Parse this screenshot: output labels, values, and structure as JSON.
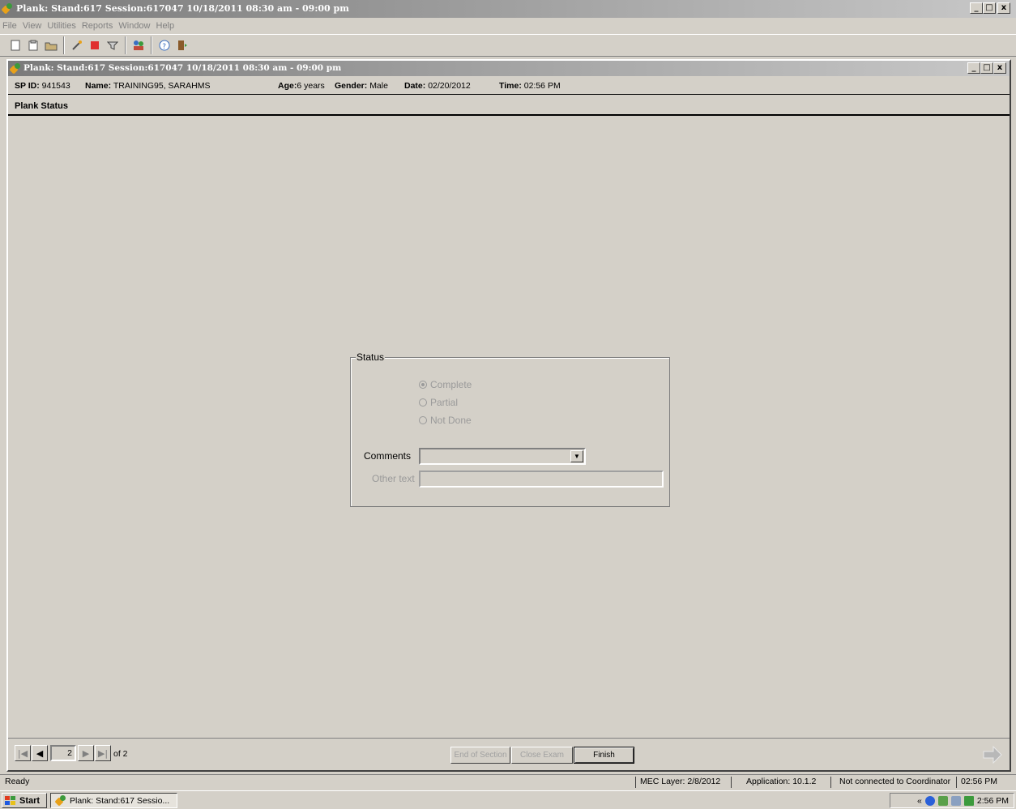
{
  "window": {
    "title": "Plank: Stand:617 Session:617047 10/18/2011 08:30 am - 09:00 pm",
    "controls": [
      "_",
      "̅",
      "x"
    ]
  },
  "menu": [
    "File",
    "View",
    "Utilities",
    "Reports",
    "Window",
    "Help"
  ],
  "toolbar": {
    "icons": [
      "new-doc-icon",
      "clipboard-icon",
      "open-folder-icon",
      "wand-icon",
      "stop-icon",
      "filter-icon",
      "people-icon",
      "help-icon",
      "exit-door-icon"
    ]
  },
  "child_window": {
    "title": "Plank: Stand:617 Session:617047 10/18/2011 08:30 am - 09:00 pm"
  },
  "participant": {
    "sp_id_label": "SP ID:",
    "sp_id": "941543",
    "name_label": "Name:",
    "name": "TRAINING95, SARAHMS",
    "age_label": "Age:",
    "age": "6 years",
    "gender_label": "Gender:",
    "gender": "Male",
    "date_label": "Date:",
    "date": "02/20/2012",
    "time_label": "Time:",
    "time": "02:56 PM"
  },
  "section": {
    "title": "Plank Status"
  },
  "status_group": {
    "label": "Status",
    "options": [
      {
        "label": "Complete",
        "selected": true
      },
      {
        "label": "Partial",
        "selected": false
      },
      {
        "label": "Not Done",
        "selected": false
      }
    ],
    "comments_label": "Comments",
    "comments_value": "",
    "other_text_label": "Other text",
    "other_text_value": ""
  },
  "navigation": {
    "page": "2",
    "of_label": "of 2",
    "end_of_section": "End of Section",
    "close_exam": "Close Exam",
    "finish": "Finish"
  },
  "statusbar": {
    "ready": "Ready",
    "mec_layer": "MEC Layer: 2/8/2012",
    "application": "Application: 10.1.2",
    "coordinator": "Not connected to Coordinator",
    "time": "02:56 PM"
  },
  "taskbar": {
    "start": "Start",
    "task": "Plank: Stand:617 Sessio...",
    "tray_prefix": "«",
    "clock": "2:56 PM"
  }
}
